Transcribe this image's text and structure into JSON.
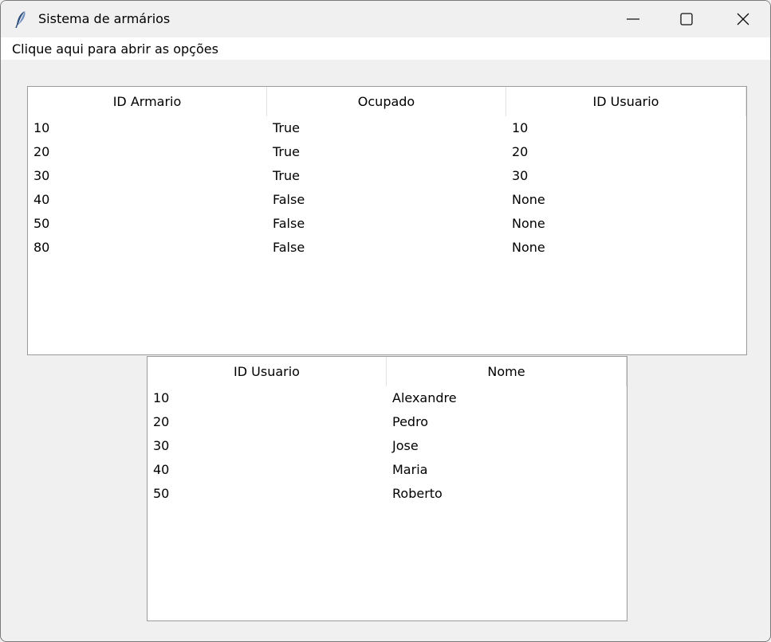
{
  "window": {
    "title": "Sistema de armários",
    "icon": "feather-icon",
    "controls": [
      "minimize-icon",
      "maximize-icon",
      "close-icon"
    ]
  },
  "menu": {
    "label": "Clique aqui para abrir as opções"
  },
  "armarios_table": {
    "columns": [
      "ID Armario",
      "Ocupado",
      "ID Usuario"
    ],
    "rows": [
      [
        "10",
        "True",
        "10"
      ],
      [
        "20",
        "True",
        "20"
      ],
      [
        "30",
        "True",
        "30"
      ],
      [
        "40",
        "False",
        "None"
      ],
      [
        "50",
        "False",
        "None"
      ],
      [
        "80",
        "False",
        "None"
      ]
    ]
  },
  "usuarios_table": {
    "columns": [
      "ID Usuario",
      "Nome"
    ],
    "rows": [
      [
        "10",
        "Alexandre"
      ],
      [
        "20",
        "Pedro"
      ],
      [
        "30",
        "Jose"
      ],
      [
        "40",
        "Maria"
      ],
      [
        "50",
        "Roberto"
      ]
    ]
  }
}
